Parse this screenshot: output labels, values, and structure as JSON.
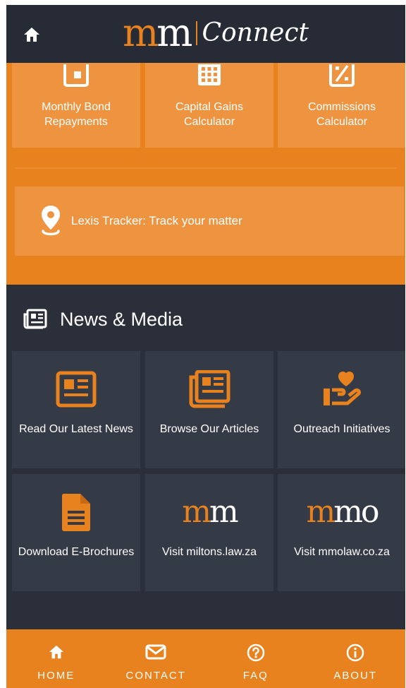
{
  "header": {
    "home_icon": "home-icon",
    "logo": {
      "mark_orange": "m",
      "mark_white": "m",
      "bar": "|",
      "text": "Connect"
    }
  },
  "tools": {
    "items": [
      {
        "icon": "square-icon",
        "label": "Monthly Bond Repayments"
      },
      {
        "icon": "calculator-icon",
        "label": "Capital Gains Calculator"
      },
      {
        "icon": "percent-icon",
        "label": "Commissions Calculator"
      }
    ],
    "tracker": {
      "icon": "location-pin-icon",
      "label": "Lexis Tracker: Track your matter"
    }
  },
  "news": {
    "title": "News & Media",
    "icon": "newspaper-icon",
    "cards": [
      {
        "icon": "newspaper-icon",
        "label": "Read Our Latest News"
      },
      {
        "icon": "articles-icon",
        "label": "Browse Our Articles"
      },
      {
        "icon": "heart-hand-icon",
        "label": "Outreach Initiatives"
      },
      {
        "icon": "document-icon",
        "label": "Download E-Brochures"
      },
      {
        "brand": {
          "orange": "m",
          "white": "m"
        },
        "label": "Visit miltons.law.za"
      },
      {
        "brand": {
          "orange": "m",
          "white": "mo"
        },
        "label": "Visit mmolaw.co.za"
      }
    ]
  },
  "nav": {
    "items": [
      {
        "icon": "home-icon",
        "label": "HOME"
      },
      {
        "icon": "mail-icon",
        "label": "CONTACT"
      },
      {
        "icon": "question-icon",
        "label": "FAQ"
      },
      {
        "icon": "info-icon",
        "label": "ABOUT"
      }
    ]
  },
  "colors": {
    "accent": "#e8821e",
    "dark": "#2b2f3a",
    "card": "#353a47"
  }
}
